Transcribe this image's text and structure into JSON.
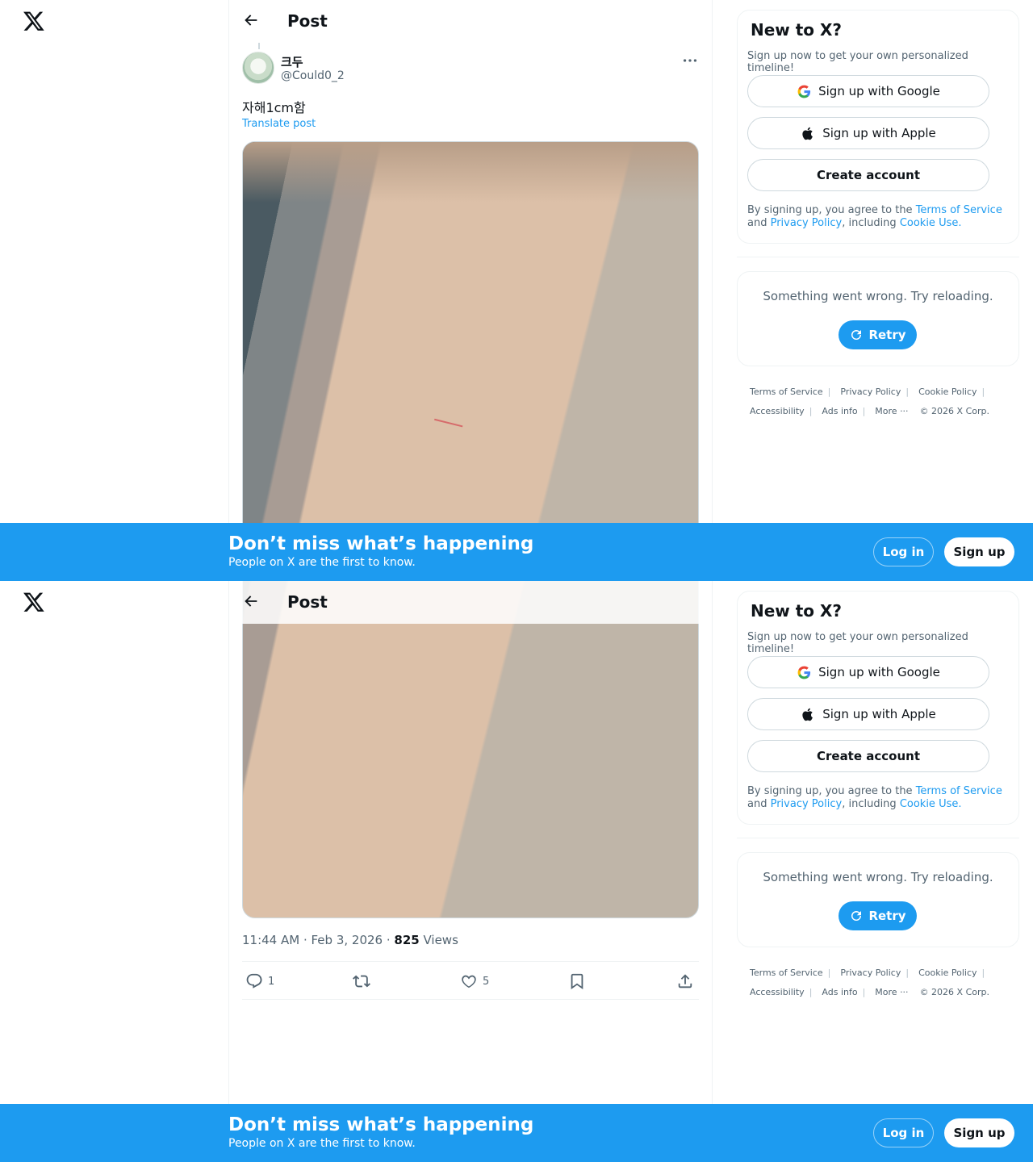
{
  "header": {
    "title": "Post"
  },
  "post": {
    "display_name": "크두",
    "handle": "@Could0_2",
    "text": "자해1cm함",
    "translate_label": "Translate post",
    "timestamp": "11:44 AM · Feb 3, 2026 · ",
    "views_count": "825",
    "views_label": " Views",
    "reply_count": "1",
    "like_count": "5"
  },
  "signup_card": {
    "title": "New to X?",
    "subtitle": "Sign up now to get your own personalized timeline!",
    "google_label": "Sign up with Google",
    "apple_label": "Sign up with Apple",
    "create_label": "Create account",
    "terms_prefix": "By signing up, you agree to the ",
    "terms_link": "Terms of Service",
    "terms_and": " and ",
    "privacy_link": "Privacy Policy",
    "terms_including": ", including ",
    "cookie_link": "Cookie Use."
  },
  "error_card": {
    "message": "Something went wrong. Try reloading.",
    "retry_label": "Retry"
  },
  "footer": {
    "terms": "Terms of Service",
    "privacy": "Privacy Policy",
    "cookie": "Cookie Policy",
    "accessibility": "Accessibility",
    "ads": "Ads info",
    "more": "More ···",
    "copyright": "© 2026 X Corp."
  },
  "banner": {
    "headline": "Don’t miss what’s happening",
    "subline": "People on X are the first to know.",
    "login_label": "Log in",
    "signup_label": "Sign up"
  },
  "colors": {
    "accent": "#1d9bf0",
    "text": "#0f1419",
    "muted": "#536471",
    "border": "#eff3f4"
  },
  "icons": [
    "x-logo-icon",
    "back-arrow-icon",
    "more-icon",
    "reply-icon",
    "repost-icon",
    "like-icon",
    "bookmark-icon",
    "share-icon",
    "google-icon",
    "apple-icon",
    "retry-icon"
  ]
}
